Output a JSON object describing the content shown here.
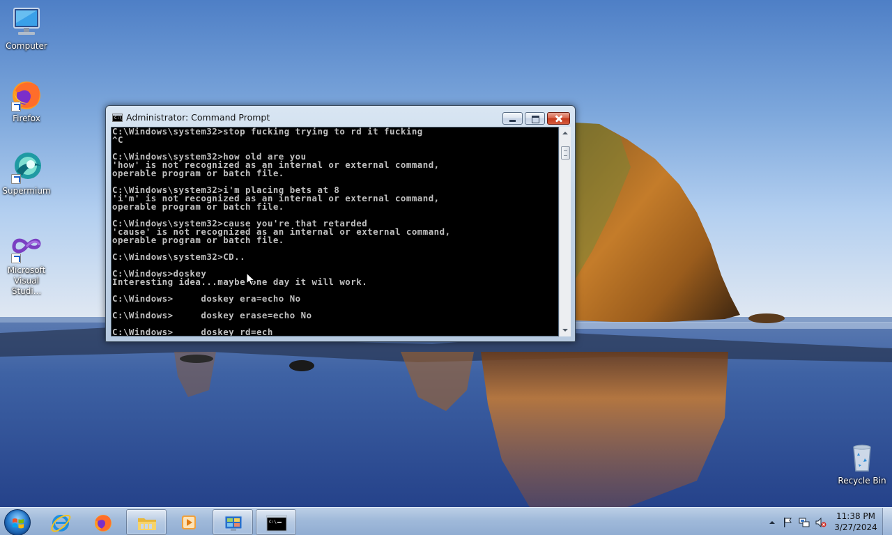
{
  "desktop": {
    "icons": [
      {
        "label": "Computer",
        "icon": "computer-icon"
      },
      {
        "label": "Firefox",
        "icon": "firefox-icon"
      },
      {
        "label": "Supermium",
        "icon": "supermium-icon"
      },
      {
        "label": "Microsoft Visual Studi...",
        "icon": "visual-studio-icon"
      },
      {
        "label": "Recycle Bin",
        "icon": "recycle-bin-icon"
      }
    ]
  },
  "cmd_window": {
    "title": "Administrator:  Command Prompt",
    "lines": [
      "C:\\Windows\\system32>stop fucking trying to rd it fucking",
      "^C",
      "",
      "C:\\Windows\\system32>how old are you",
      "'how' is not recognized as an internal or external command,",
      "operable program or batch file.",
      "",
      "C:\\Windows\\system32>i'm placing bets at 8",
      "'i'm' is not recognized as an internal or external command,",
      "operable program or batch file.",
      "",
      "C:\\Windows\\system32>cause you're that retarded",
      "'cause' is not recognized as an internal or external command,",
      "operable program or batch file.",
      "",
      "C:\\Windows\\system32>CD..",
      "",
      "C:\\Windows>doskey",
      "Interesting idea...maybe one day it will work.",
      "",
      "C:\\Windows>     doskey era=echo No",
      "",
      "C:\\Windows>     doskey erase=echo No",
      "",
      "C:\\Windows>     doskey rd=ech"
    ]
  },
  "taskbar": {
    "pinned": [
      {
        "name": "internet-explorer",
        "icon": "internet-explorer-icon",
        "active": false
      },
      {
        "name": "firefox",
        "icon": "firefox-icon",
        "active": false
      },
      {
        "name": "file-explorer",
        "icon": "folder-icon",
        "active": true
      },
      {
        "name": "media-player",
        "icon": "media-player-icon",
        "active": false
      },
      {
        "name": "control-panel",
        "icon": "control-panel-icon",
        "active": true
      },
      {
        "name": "command-prompt",
        "icon": "command-prompt-icon",
        "active": true
      }
    ],
    "tray": {
      "icons": [
        "show-hidden-icons-icon",
        "action-center-flag-icon",
        "network-icon",
        "volume-muted-icon"
      ]
    },
    "clock": {
      "time": "11:38 PM",
      "date": "3/27/2024"
    }
  },
  "colors": {
    "console_bg": "#000000",
    "console_fg": "#c0c0c0",
    "close_button": "#c43b1e",
    "taskbar": "#aac3e1"
  }
}
